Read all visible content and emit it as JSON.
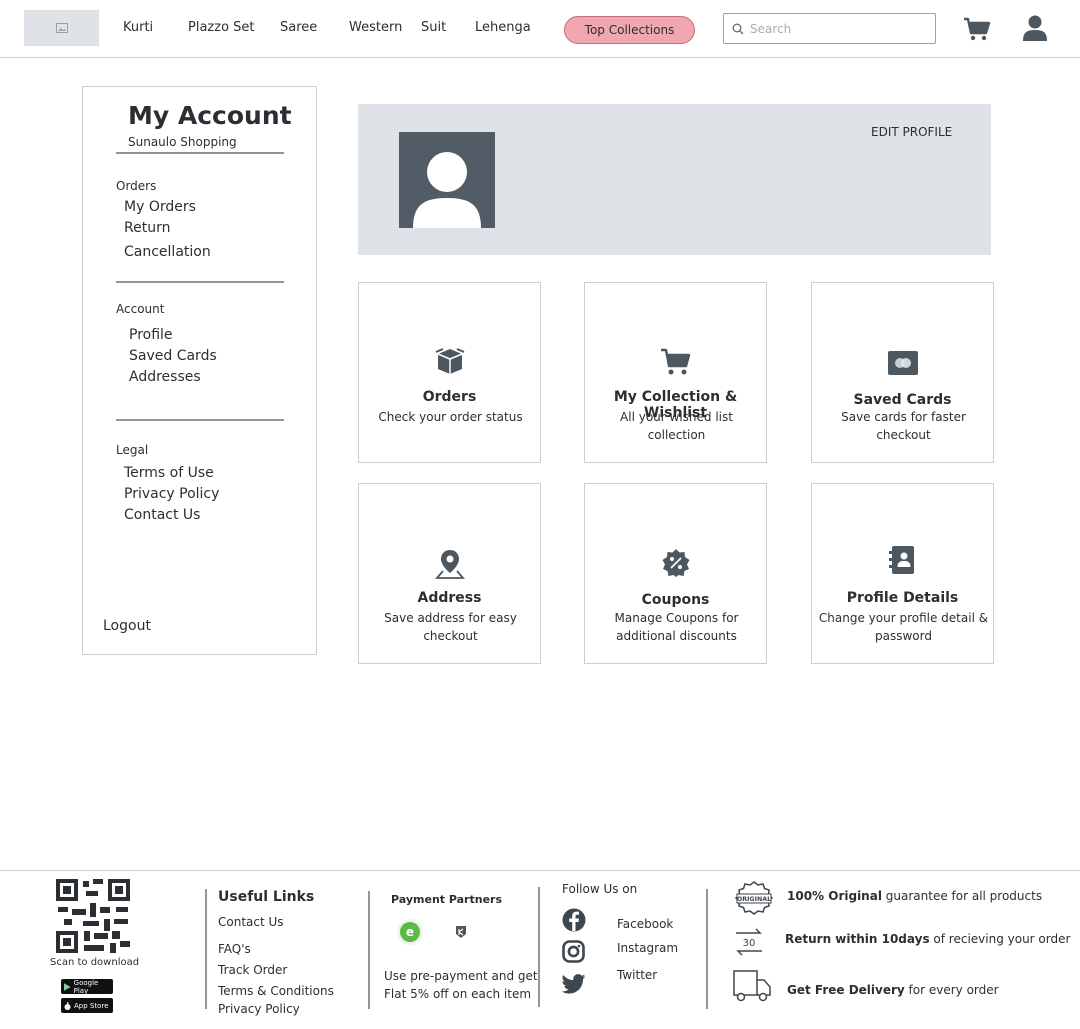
{
  "header": {
    "nav": [
      "Kurti",
      "Plazzo Set",
      "Saree",
      "Western",
      "Suit",
      "Lehenga"
    ],
    "top_collections": "Top Collections",
    "search_placeholder": "Search"
  },
  "sidebar": {
    "title": "My Account",
    "subtitle": "Sunaulo Shopping",
    "sections": [
      {
        "heading": "Orders",
        "items": [
          "My Orders",
          "Return",
          "Cancellation"
        ]
      },
      {
        "heading": "Account",
        "items": [
          "Profile",
          "Saved Cards",
          "Addresses"
        ]
      },
      {
        "heading": "Legal",
        "items": [
          "Terms of Use",
          "Privacy Policy",
          "Contact Us"
        ]
      }
    ],
    "logout": "Logout"
  },
  "profile": {
    "edit_label": "EDIT PROFILE"
  },
  "cards": [
    {
      "icon": "box-icon",
      "title": "Orders",
      "desc": "Check your order status"
    },
    {
      "icon": "cart-icon",
      "title": "My Collection & Wishlist",
      "desc": "All your wished list collection"
    },
    {
      "icon": "card-icon",
      "title": "Saved Cards",
      "desc": "Save cards for faster checkout"
    },
    {
      "icon": "location-pin-icon",
      "title": "Address",
      "desc": "Save address for easy checkout"
    },
    {
      "icon": "coupon-badge-icon",
      "title": "Coupons",
      "desc": "Manage Coupons for additional discounts"
    },
    {
      "icon": "contact-book-icon",
      "title": "Profile Details",
      "desc": "Change your profile detail & password"
    }
  ],
  "footer": {
    "scan_label": "Scan to download",
    "google_play": "Google Play",
    "app_store": "App Store",
    "useful_links_title": "Useful Links",
    "useful_links": [
      "Contact Us",
      "FAQ's",
      "Track Order",
      "Terms & Conditions",
      "Privacy Policy"
    ],
    "payment_title": "Payment Partners",
    "payment_note_1": "Use pre-payment and get",
    "payment_note_2": "Flat 5% off on each item",
    "follow_title": "Follow Us on",
    "social": [
      "Facebook",
      "Instagram",
      "Twitter"
    ],
    "badge_original": "ORIGINAL",
    "badge_30": "30",
    "promises": [
      {
        "bold": "100% Original",
        "rest": " guarantee for all products"
      },
      {
        "bold": "Return within 10days",
        "rest": " of recieving your order"
      },
      {
        "bold": "Get Free Delivery",
        "rest": " for every order"
      }
    ]
  }
}
